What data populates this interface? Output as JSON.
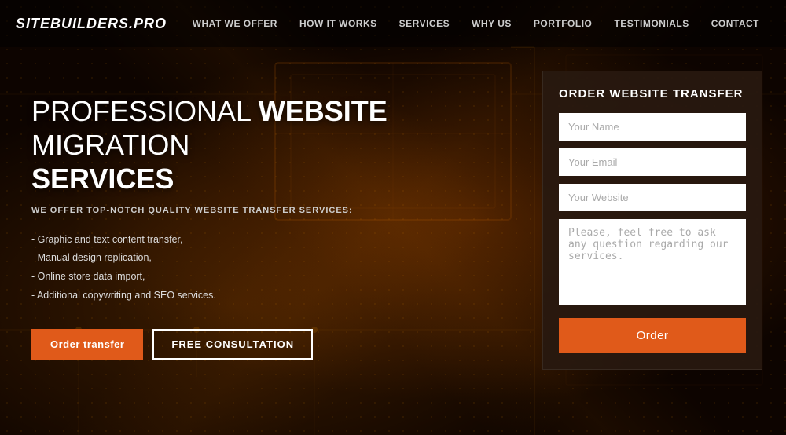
{
  "logo": "SITEBUILDERS.PRO",
  "nav": {
    "links": [
      {
        "label": "WHAT WE OFFER",
        "name": "what-we-offer"
      },
      {
        "label": "HOW IT WORKS",
        "name": "how-it-works"
      },
      {
        "label": "SERVICES",
        "name": "services"
      },
      {
        "label": "WHY US",
        "name": "why-us"
      },
      {
        "label": "PORTFOLIO",
        "name": "portfolio"
      },
      {
        "label": "TESTIMONIALS",
        "name": "testimonials"
      },
      {
        "label": "CONTACT",
        "name": "contact"
      }
    ]
  },
  "hero": {
    "title_part1": "PROFESSIONAL ",
    "title_bold": "WEBSITE",
    "title_part2": " MIGRATION",
    "title_line2": "SERVICES",
    "subtitle": "WE OFFER TOP-NOTCH QUALITY WEBSITE TRANSFER SERVICES:",
    "list": [
      "- Graphic and text content transfer,",
      "- Manual design replication,",
      "- Online store data import,",
      "- Additional copywriting and SEO services."
    ],
    "btn_order": "Order transfer",
    "btn_consult": "FREE CONSULTATION"
  },
  "form": {
    "title": "ORDER WEBSITE TRANSFER",
    "name_placeholder": "Your Name",
    "email_placeholder": "Your Email",
    "website_placeholder": "Your Website",
    "message_placeholder": "Please, feel free to ask any question regarding our services.",
    "submit_label": "Order"
  },
  "colors": {
    "accent": "#e05a1a",
    "bg_dark": "#0d0400",
    "form_bg": "rgba(40,25,15,0.92)"
  }
}
